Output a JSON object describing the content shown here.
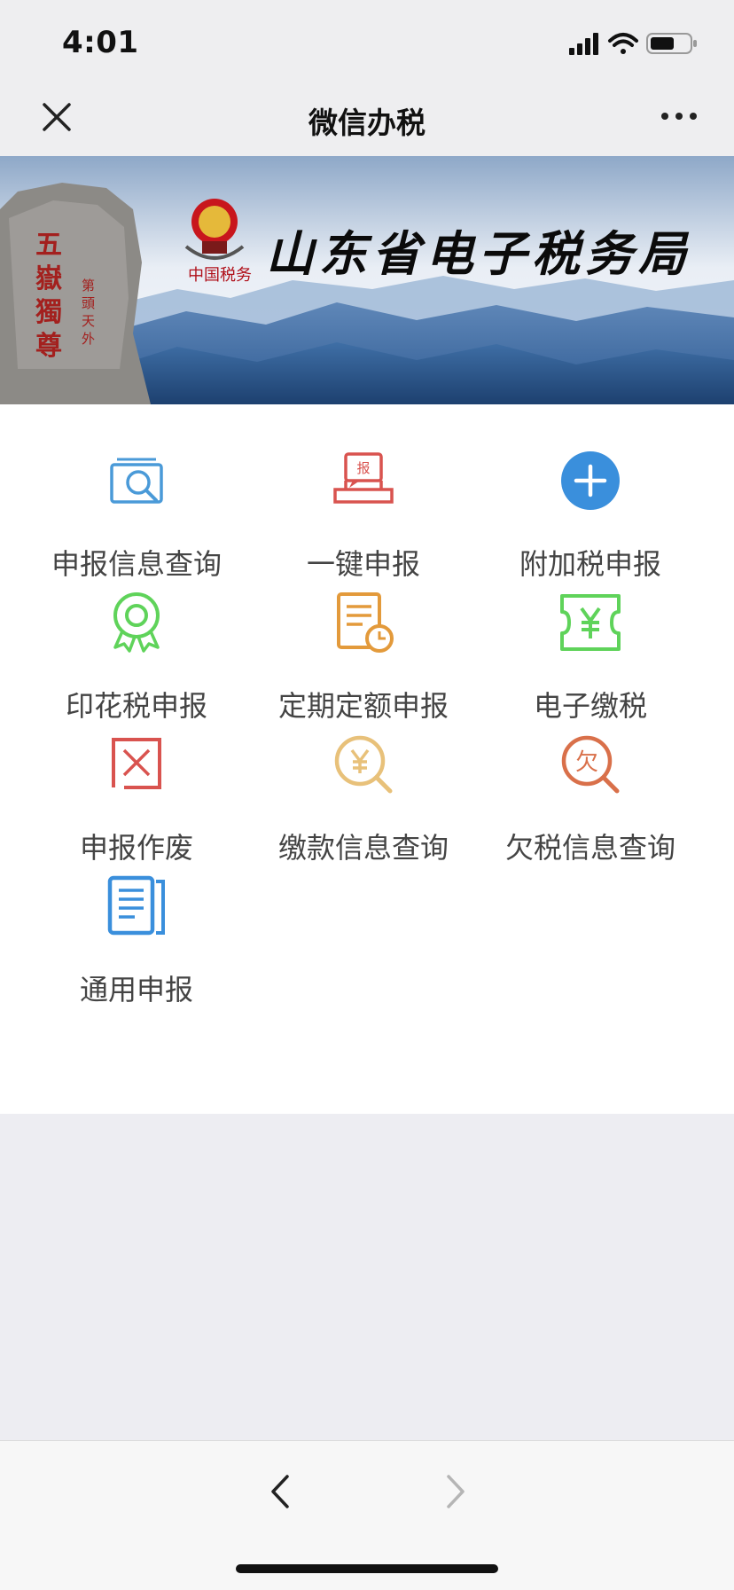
{
  "status_bar": {
    "time": "4:01"
  },
  "navbar": {
    "title": "微信办税"
  },
  "banner": {
    "title": "山东省电子税务局",
    "emblem_text": "中国税务",
    "rock_text_main": "五嶽獨尊",
    "rock_text_side": "第頭天外"
  },
  "services": [
    {
      "label": "申报信息查询",
      "icon": "search-document-icon",
      "color": "#4a9ad8"
    },
    {
      "label": "一键申报",
      "icon": "report-laptop-icon",
      "color": "#d9534f"
    },
    {
      "label": "附加税申报",
      "icon": "plus-circle-icon",
      "color": "#3a8fdc"
    },
    {
      "label": "印花税申报",
      "icon": "ribbon-award-icon",
      "color": "#5fd35a"
    },
    {
      "label": "定期定额申报",
      "icon": "document-clock-icon",
      "color": "#e39a3b"
    },
    {
      "label": "电子缴税",
      "icon": "yen-ticket-icon",
      "color": "#5fd35a"
    },
    {
      "label": "申报作废",
      "icon": "cancel-box-icon",
      "color": "#d9534f"
    },
    {
      "label": "缴款信息查询",
      "icon": "yen-search-icon",
      "color": "#e8c17a"
    },
    {
      "label": "欠税信息查询",
      "icon": "owed-search-icon",
      "color": "#d9704a"
    },
    {
      "label": "通用申报",
      "icon": "documents-icon",
      "color": "#3a8fdc"
    }
  ]
}
